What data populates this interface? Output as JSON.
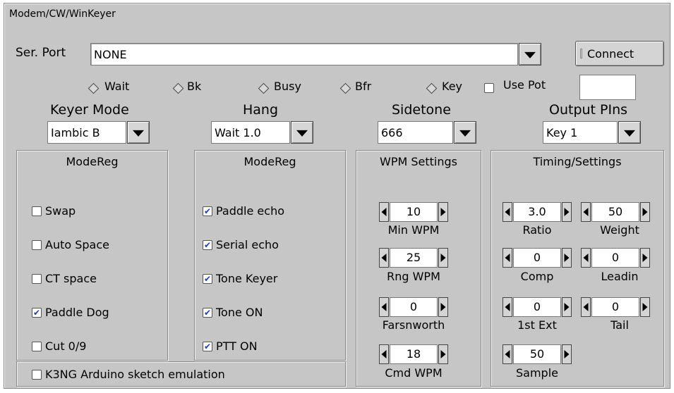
{
  "tab": {
    "title": "Modem/CW/WinKeyer"
  },
  "port": {
    "label": "Ser. Port",
    "value": "NONE",
    "connect_label": "Connect"
  },
  "status": {
    "wait": "Wait",
    "bk": "Bk",
    "busy": "Busy",
    "bfr": "Bfr",
    "key": "Key",
    "use_pot": "Use Pot",
    "pot_value": ""
  },
  "selectors": {
    "keyer_mode": {
      "label": "Keyer Mode",
      "value": "Iambic B"
    },
    "hang": {
      "label": "Hang",
      "value": "Wait 1.0"
    },
    "sidetone": {
      "label": "Sidetone",
      "value": "666"
    },
    "output_pins": {
      "label": "Output PIns",
      "value": "Key 1"
    }
  },
  "modereg1": {
    "title": "ModeReg",
    "items": [
      {
        "label": "Swap",
        "checked": false
      },
      {
        "label": "Auto Space",
        "checked": false
      },
      {
        "label": "CT space",
        "checked": false
      },
      {
        "label": "Paddle Dog",
        "checked": true
      },
      {
        "label": "Cut 0/9",
        "checked": false
      }
    ]
  },
  "modereg2": {
    "title": "ModeReg",
    "items": [
      {
        "label": "Paddle echo",
        "checked": true
      },
      {
        "label": "Serial echo",
        "checked": true
      },
      {
        "label": "Tone Keyer",
        "checked": true
      },
      {
        "label": "Tone ON",
        "checked": true
      },
      {
        "label": "PTT ON",
        "checked": true
      }
    ]
  },
  "k3ng": {
    "label": "K3NG Arduino sketch emulation",
    "checked": false
  },
  "wpm": {
    "title": "WPM Settings",
    "min": {
      "label": "Min WPM",
      "value": "10"
    },
    "rng": {
      "label": "Rng WPM",
      "value": "25"
    },
    "farns": {
      "label": "Farsnworth",
      "value": "0"
    },
    "cmd": {
      "label": "Cmd WPM",
      "value": "18"
    }
  },
  "timing": {
    "title": "Timing/Settings",
    "ratio": {
      "label": "Ratio",
      "value": "3.0"
    },
    "weight": {
      "label": "Weight",
      "value": "50"
    },
    "comp": {
      "label": "Comp",
      "value": "0"
    },
    "leadin": {
      "label": "Leadin",
      "value": "0"
    },
    "first_ext": {
      "label": "1st Ext",
      "value": "0"
    },
    "tail": {
      "label": "Tail",
      "value": "0"
    },
    "sample": {
      "label": "Sample",
      "value": "50"
    }
  },
  "check_mark": "✔"
}
